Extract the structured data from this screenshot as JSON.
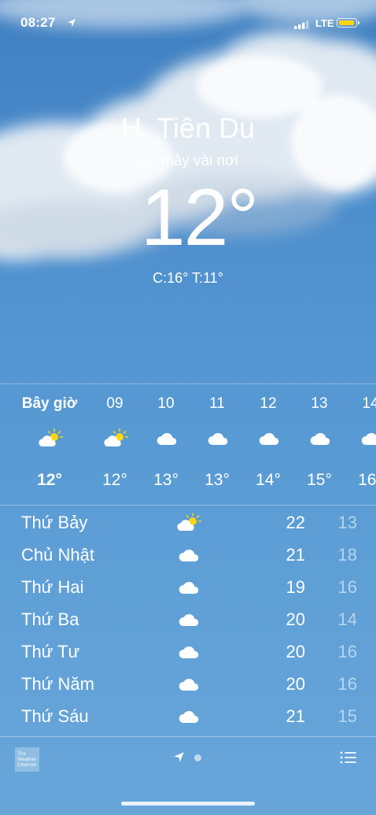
{
  "status_bar": {
    "time": "08:27",
    "network": "LTE"
  },
  "header": {
    "location": "H. Tiên Du",
    "condition": "Có mây vài nơi",
    "temperature": "12°",
    "high_low": "C:16°  T:11°"
  },
  "hourly": [
    {
      "label": "Bây giờ",
      "icon": "partly-sunny-icon",
      "temp": "12°"
    },
    {
      "label": "09",
      "icon": "partly-sunny-icon",
      "temp": "12°"
    },
    {
      "label": "10",
      "icon": "cloud-icon",
      "temp": "13°"
    },
    {
      "label": "11",
      "icon": "cloud-icon",
      "temp": "13°"
    },
    {
      "label": "12",
      "icon": "cloud-icon",
      "temp": "14°"
    },
    {
      "label": "13",
      "icon": "cloud-icon",
      "temp": "15°"
    },
    {
      "label": "14",
      "icon": "cloud-icon",
      "temp": "16°"
    }
  ],
  "daily": [
    {
      "day": "Thứ Bảy",
      "icon": "partly-sunny-icon",
      "high": "22",
      "low": "13"
    },
    {
      "day": "Chủ Nhật",
      "icon": "cloud-icon",
      "high": "21",
      "low": "18"
    },
    {
      "day": "Thứ Hai",
      "icon": "cloud-icon",
      "high": "19",
      "low": "16"
    },
    {
      "day": "Thứ Ba",
      "icon": "cloud-icon",
      "high": "20",
      "low": "14"
    },
    {
      "day": "Thứ Tư",
      "icon": "cloud-icon",
      "high": "20",
      "low": "16"
    },
    {
      "day": "Thứ Năm",
      "icon": "cloud-icon",
      "high": "20",
      "low": "16"
    },
    {
      "day": "Thứ Sáu",
      "icon": "cloud-icon",
      "high": "21",
      "low": "15"
    }
  ],
  "footer": {
    "provider_logo": "The Weather Channel"
  },
  "colors": {
    "sky_top": "#3f7fc0",
    "sky_bottom": "#68a6da",
    "sun": "#ffd60a"
  }
}
